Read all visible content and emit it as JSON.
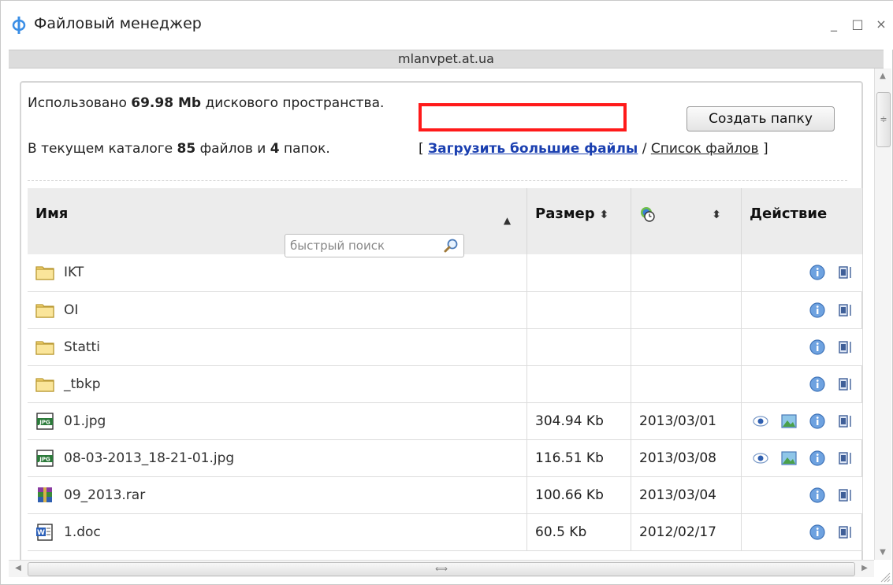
{
  "window": {
    "title": "Файловый менеджер",
    "host": "mlanvpet.at.ua",
    "minimize": "_",
    "maximize": "□",
    "close": "×"
  },
  "info": {
    "used_prefix": "Использовано",
    "used_value": "69.98 Mb",
    "used_suffix": "дискового пространства.",
    "dir_prefix": "В текущем каталоге",
    "files_count": "85",
    "files_word": "файлов и",
    "folders_count": "4",
    "folders_word": "папок."
  },
  "links": {
    "open_bracket": "[",
    "upload_big": "Загрузить большие файлы",
    "slash": "/",
    "file_list": "Список файлов",
    "close_bracket": "]"
  },
  "create_folder_label": "Создать папку",
  "table": {
    "headers": {
      "name": "Имя",
      "size": "Размер",
      "action": "Действие"
    },
    "quick_search_placeholder": "быстрый поиск",
    "rows": [
      {
        "name": "IKT",
        "type": "folder",
        "size": "",
        "date": ""
      },
      {
        "name": "OI",
        "type": "folder",
        "size": "",
        "date": ""
      },
      {
        "name": "Statti",
        "type": "folder",
        "size": "",
        "date": ""
      },
      {
        "name": "_tbkp",
        "type": "folder",
        "size": "",
        "date": ""
      },
      {
        "name": "01.jpg",
        "type": "jpg",
        "size": "304.94 Kb",
        "date": "2013/03/01"
      },
      {
        "name": "08-03-2013_18-21-01.jpg",
        "type": "jpg",
        "size": "116.51 Kb",
        "date": "2013/03/08"
      },
      {
        "name": "09_2013.rar",
        "type": "rar",
        "size": "100.66 Kb",
        "date": "2013/03/04"
      },
      {
        "name": "1.doc",
        "type": "doc",
        "size": "60.5 Kb",
        "date": "2012/02/17"
      }
    ]
  },
  "colors": {
    "highlight_box": "#ff1a1a",
    "link": "#1a3fb0",
    "header_bg": "#ececec"
  }
}
